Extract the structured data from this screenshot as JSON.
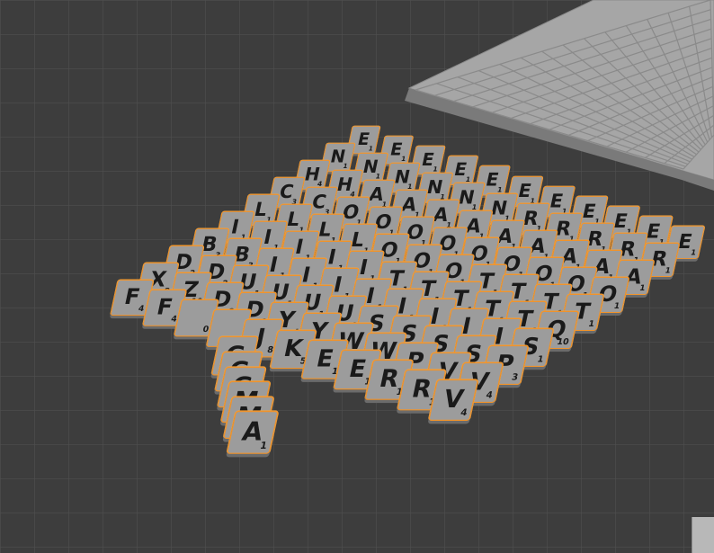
{
  "scene": {
    "background_color": "#3d3d3d",
    "grid_line_color": "#505050",
    "selection_outline_color": "#f0932b",
    "tile_color": "#9c9c9c",
    "board_color": "#a8a8a8"
  },
  "tiles": [
    [
      {
        "l": "E",
        "s": "1"
      },
      {
        "l": "E",
        "s": "1"
      },
      {
        "l": "E",
        "s": "1"
      },
      {
        "l": "E",
        "s": "1"
      },
      {
        "l": "E",
        "s": "1"
      },
      {
        "l": "E",
        "s": "1"
      },
      {
        "l": "E",
        "s": "1"
      },
      {
        "l": "E",
        "s": "1"
      },
      {
        "l": "E",
        "s": "1"
      },
      {
        "l": "E",
        "s": "1"
      },
      {
        "l": "E",
        "s": "1"
      }
    ],
    [
      {
        "l": "N",
        "s": "1"
      },
      {
        "l": "N",
        "s": "1"
      },
      {
        "l": "N",
        "s": "1"
      },
      {
        "l": "N",
        "s": "1"
      },
      {
        "l": "N",
        "s": "1"
      },
      {
        "l": "N",
        "s": "1"
      },
      {
        "l": "R",
        "s": "1"
      },
      {
        "l": "R",
        "s": "1"
      },
      {
        "l": "R",
        "s": "1"
      },
      {
        "l": "R",
        "s": "1"
      },
      {
        "l": "R",
        "s": "1"
      }
    ],
    [
      {
        "l": "H",
        "s": "4"
      },
      {
        "l": "H",
        "s": "4"
      },
      {
        "l": "A",
        "s": "1"
      },
      {
        "l": "A",
        "s": "1"
      },
      {
        "l": "A",
        "s": "1"
      },
      {
        "l": "A",
        "s": "1"
      },
      {
        "l": "A",
        "s": "1"
      },
      {
        "l": "A",
        "s": "1"
      },
      {
        "l": "A",
        "s": "1"
      },
      {
        "l": "A",
        "s": "1"
      },
      {
        "l": "A",
        "s": "1"
      }
    ],
    [
      {
        "l": "C",
        "s": "3"
      },
      {
        "l": "C",
        "s": "3"
      },
      {
        "l": "O",
        "s": "1"
      },
      {
        "l": "O",
        "s": "1"
      },
      {
        "l": "O",
        "s": "1"
      },
      {
        "l": "O",
        "s": "1"
      },
      {
        "l": "O",
        "s": "1"
      },
      {
        "l": "O",
        "s": "1"
      },
      {
        "l": "O",
        "s": "1"
      },
      {
        "l": "O",
        "s": "1"
      },
      {
        "l": "O",
        "s": "1"
      }
    ],
    [
      {
        "l": "L",
        "s": "1"
      },
      {
        "l": "L",
        "s": "1"
      },
      {
        "l": "L",
        "s": "1"
      },
      {
        "l": "L",
        "s": "1"
      },
      {
        "l": "O",
        "s": "1"
      },
      {
        "l": "O",
        "s": "1"
      },
      {
        "l": "O",
        "s": "1"
      },
      {
        "l": "T",
        "s": "1"
      },
      {
        "l": "T",
        "s": "1"
      },
      {
        "l": "T",
        "s": "1"
      },
      {
        "l": "T",
        "s": "1"
      }
    ],
    [
      {
        "l": "I",
        "s": "1"
      },
      {
        "l": "I",
        "s": "1"
      },
      {
        "l": "I",
        "s": "1"
      },
      {
        "l": "I",
        "s": "1"
      },
      {
        "l": "I",
        "s": "1"
      },
      {
        "l": "T",
        "s": "1"
      },
      {
        "l": "T",
        "s": "1"
      },
      {
        "l": "T",
        "s": "1"
      },
      {
        "l": "T",
        "s": "1"
      },
      {
        "l": "T",
        "s": "1"
      },
      {
        "l": "Q",
        "s": "10"
      }
    ],
    [
      {
        "l": "B",
        "s": "3"
      },
      {
        "l": "B",
        "s": "3"
      },
      {
        "l": "I",
        "s": "1"
      },
      {
        "l": "I",
        "s": "1"
      },
      {
        "l": "I",
        "s": "1"
      },
      {
        "l": "I",
        "s": "1"
      },
      {
        "l": "I",
        "s": "1"
      },
      {
        "l": "I",
        "s": "1"
      },
      {
        "l": "I",
        "s": "1"
      },
      {
        "l": "I",
        "s": "1"
      },
      {
        "l": "S",
        "s": "1"
      }
    ],
    [
      {
        "l": "D",
        "s": "2"
      },
      {
        "l": "D",
        "s": "2"
      },
      {
        "l": "U",
        "s": "1"
      },
      {
        "l": "U",
        "s": "1"
      },
      {
        "l": "U",
        "s": "1"
      },
      {
        "l": "U",
        "s": "1"
      },
      {
        "l": "S",
        "s": "1"
      },
      {
        "l": "S",
        "s": "1"
      },
      {
        "l": "S",
        "s": "1"
      },
      {
        "l": "S",
        "s": "1"
      },
      {
        "l": "P",
        "s": "3"
      }
    ],
    [
      {
        "l": "X",
        "s": "8"
      },
      {
        "l": "Z",
        "s": "10"
      },
      {
        "l": "D",
        "s": "2"
      },
      {
        "l": "D",
        "s": "2"
      },
      {
        "l": "Y",
        "s": "4"
      },
      {
        "l": "Y",
        "s": "4"
      },
      {
        "l": "W",
        "s": "4"
      },
      {
        "l": "W",
        "s": "4"
      },
      {
        "l": "P",
        "s": "3"
      },
      {
        "l": "V",
        "s": "4"
      },
      {
        "l": "V",
        "s": "4"
      }
    ],
    [
      {
        "l": "F",
        "s": "4"
      },
      {
        "l": "F",
        "s": "4"
      },
      {
        "l": "",
        "s": "0"
      },
      {
        "l": "",
        "s": "0"
      },
      {
        "l": "J",
        "s": "8"
      },
      {
        "l": "K",
        "s": "5"
      },
      {
        "l": "E",
        "s": "1"
      },
      {
        "l": "E",
        "s": "1"
      },
      {
        "l": "R",
        "s": "1"
      },
      {
        "l": "R",
        "s": "1"
      },
      {
        "l": "V",
        "s": "4"
      }
    ],
    [
      {
        "l": "G",
        "s": "2"
      },
      {
        "l": "G",
        "s": "2"
      },
      {
        "l": "G",
        "s": "2"
      },
      {
        "l": "M",
        "s": "3"
      },
      {
        "l": "M",
        "s": "3"
      },
      {
        "l": "A",
        "s": "1"
      }
    ]
  ]
}
